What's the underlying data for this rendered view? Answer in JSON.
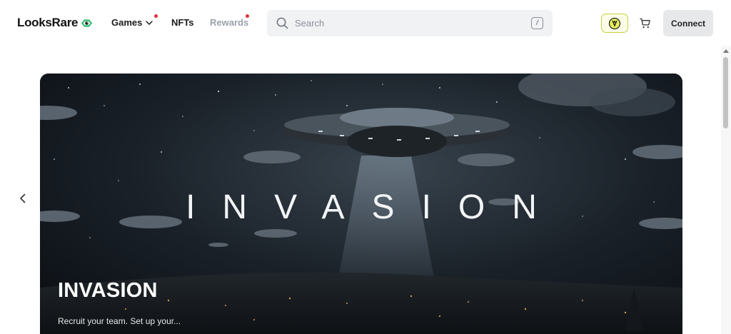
{
  "header": {
    "logo_text": "LooksRare",
    "logo_icon": "eye-icon",
    "nav": [
      {
        "label": "Games",
        "has_dropdown": true,
        "has_notification": true
      },
      {
        "label": "NFTs",
        "has_dropdown": false,
        "has_notification": false
      },
      {
        "label": "Rewards",
        "has_dropdown": false,
        "has_notification": true,
        "muted": true
      }
    ],
    "search": {
      "placeholder": "Search",
      "shortcut": "/"
    },
    "rewards_icon": "rewards-badge-icon",
    "cart_icon": "cart-icon",
    "connect_label": "Connect"
  },
  "carousel": {
    "banner": {
      "logo_text": "INVASION",
      "title": "INVASION",
      "description": "Recruit your team. Set up your..."
    },
    "prev_icon": "chevron-left-icon"
  },
  "colors": {
    "notification_dot": "#e0323c",
    "brand_green": "#2dbe6c",
    "rewards_badge_border": "#c9cf3c",
    "connect_bg": "#e7e8ea"
  }
}
